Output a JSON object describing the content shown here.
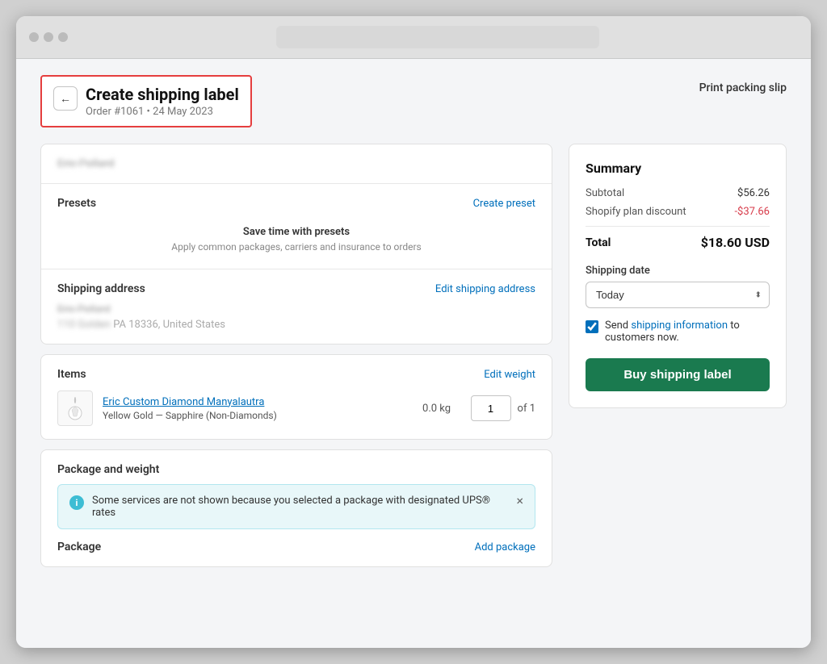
{
  "browser": {
    "dots": [
      "",
      "",
      ""
    ]
  },
  "header": {
    "back_label": "←",
    "title": "Create shipping label",
    "subtitle": "Order #1061 • 24 May 2023",
    "print_label": "Print packing slip"
  },
  "customer": {
    "name": "Eric Pollard"
  },
  "presets": {
    "section_title": "Presets",
    "create_link": "Create preset",
    "empty_title": "Save time with presets",
    "empty_desc": "Apply common packages, carriers and insurance to orders"
  },
  "shipping_address": {
    "section_title": "Shipping address",
    "edit_link": "Edit shipping address",
    "name": "Eric Pollard",
    "street": "110 Golden",
    "city_state_zip": "PA 18336, United States"
  },
  "items": {
    "section_title": "Items",
    "edit_link": "Edit weight",
    "item_name": "Eric Custom Diamond Manyalautra",
    "item_variant": "Yellow Gold — Sapphire (Non-Diamonds)",
    "item_weight": "0.0 kg",
    "item_qty": "1",
    "item_qty_of": "of 1"
  },
  "package": {
    "section_title": "Package and weight",
    "info_text": "Some services are not shown because you selected a package with designated UPS® rates",
    "add_link": "Add package",
    "package_label": "Package"
  },
  "summary": {
    "title": "Summary",
    "subtotal_label": "Subtotal",
    "subtotal_value": "$56.26",
    "discount_label": "Shopify plan discount",
    "discount_value": "-$37.66",
    "total_label": "Total",
    "total_value": "$18.60 USD",
    "shipping_date_label": "Shipping date",
    "shipping_date_option": "Today",
    "checkbox_label": "Send ",
    "checkbox_link_text": "shipping information",
    "checkbox_label2": " to customers now.",
    "buy_label": "Buy shipping label"
  }
}
